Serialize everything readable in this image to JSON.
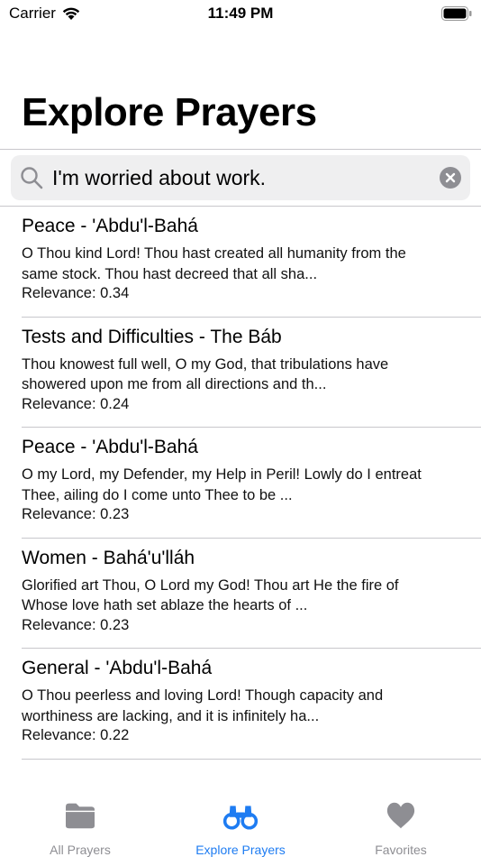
{
  "status": {
    "carrier": "Carrier",
    "time": "11:49 PM"
  },
  "page": {
    "title": "Explore Prayers"
  },
  "search": {
    "value": "I'm worried about work."
  },
  "results": [
    {
      "title": "Peace - 'Abdu'l-Bahá",
      "excerpt_line1": "O Thou kind Lord! Thou hast created all humanity from the",
      "excerpt_line2": "same stock. Thou hast decreed that all sha...",
      "relevance": "Relevance: 0.34"
    },
    {
      "title": "Tests and Difficulties - The Báb",
      "excerpt_line1": "Thou knowest full well, O my God, that tribulations have",
      "excerpt_line2": "showered upon me from all directions and th...",
      "relevance": "Relevance: 0.24"
    },
    {
      "title": "Peace - 'Abdu'l-Bahá",
      "excerpt_line1": "O my Lord, my Defender, my Help in Peril! Lowly do I entreat",
      "excerpt_line2": "Thee, ailing do I come unto Thee to be ...",
      "relevance": "Relevance: 0.23"
    },
    {
      "title": "Women - Bahá'u'lláh",
      "excerpt_line1": "Glorified art Thou, O Lord my God! Thou art He the fire of",
      "excerpt_line2": "Whose love hath set ablaze the hearts of ...",
      "relevance": "Relevance: 0.23"
    },
    {
      "title": "General - 'Abdu'l-Bahá",
      "excerpt_line1": "O Thou peerless and loving Lord! Though capacity and",
      "excerpt_line2": "worthiness are lacking, and it is infinitely ha...",
      "relevance": "Relevance: 0.22"
    }
  ],
  "tabs": [
    {
      "label": "All Prayers",
      "icon": "folder-icon",
      "active": false
    },
    {
      "label": "Explore Prayers",
      "icon": "binoculars-icon",
      "active": true
    },
    {
      "label": "Favorites",
      "icon": "heart-icon",
      "active": false
    }
  ],
  "colors": {
    "accent": "#1e7cf2",
    "inactive": "#8e8e93",
    "search_bg": "#efeff0",
    "divider": "#c8c7cc"
  }
}
